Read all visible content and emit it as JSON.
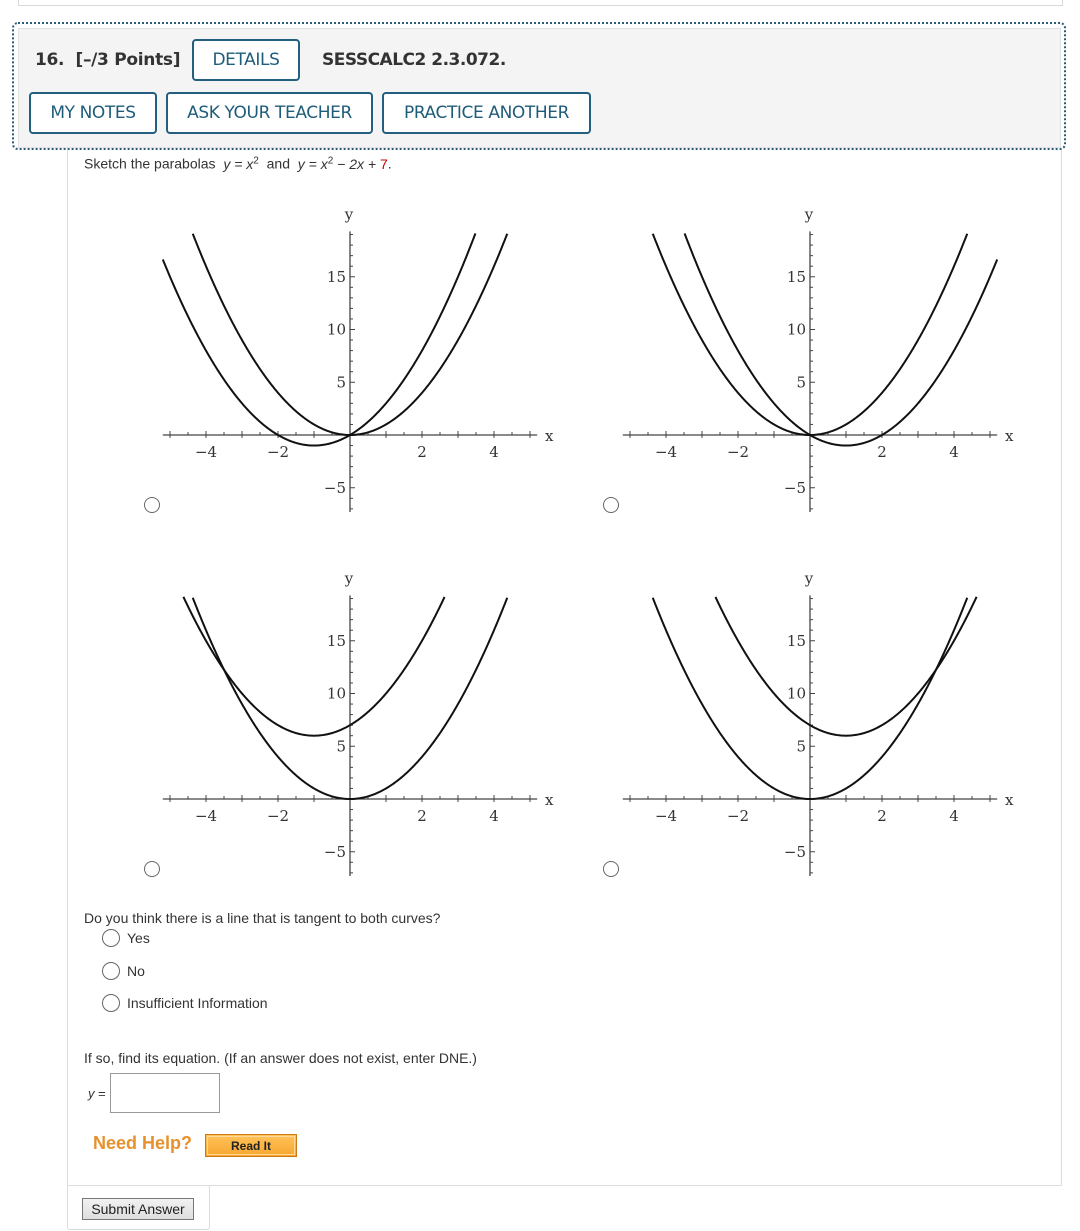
{
  "header": {
    "question_number": "16.",
    "points": "[–/3 Points]",
    "details_label": "DETAILS",
    "problem_code": "SESSCALC2 2.3.072.",
    "my_notes_label": "MY NOTES",
    "ask_teacher_label": "ASK YOUR TEACHER",
    "practice_another_label": "PRACTICE ANOTHER"
  },
  "prompt": {
    "lead": "Sketch the parabolas",
    "eq1_lhs": "y = x",
    "eq1_exp": "2",
    "conj": "and",
    "eq2_lhs": "y = x",
    "eq2_exp": "2",
    "eq2_mid": " − 2x + ",
    "eq2_const": "7",
    "end": "."
  },
  "colors": {
    "accent": "#1f5c7a",
    "need_help": "#e8912c",
    "constant_highlight": "#cc0000"
  },
  "chart_data": [
    {
      "type": "line",
      "id": "option-a",
      "xlabel": "x",
      "ylabel": "y",
      "xlim": [
        -5.2,
        5.2
      ],
      "ylim": [
        -7.3,
        19.3
      ],
      "xticks": [
        -4,
        -2,
        2,
        4
      ],
      "xtick_labels": [
        "−4",
        "−2",
        "2",
        "4"
      ],
      "yticks": [
        -5,
        5,
        10,
        15
      ],
      "ytick_labels": [
        "−5",
        "5",
        "10",
        "15"
      ],
      "grid": false,
      "series": [
        {
          "name": "y = x^2",
          "a": 1,
          "b": 0,
          "c": 0
        },
        {
          "name": "y = x^2 + 2x",
          "a": 1,
          "b": 2,
          "c": 0
        }
      ]
    },
    {
      "type": "line",
      "id": "option-b",
      "xlabel": "x",
      "ylabel": "y",
      "xlim": [
        -5.2,
        5.2
      ],
      "ylim": [
        -7.3,
        19.3
      ],
      "xticks": [
        -4,
        -2,
        2,
        4
      ],
      "xtick_labels": [
        "−4",
        "−2",
        "2",
        "4"
      ],
      "yticks": [
        -5,
        5,
        10,
        15
      ],
      "ytick_labels": [
        "−5",
        "5",
        "10",
        "15"
      ],
      "grid": false,
      "series": [
        {
          "name": "y = x^2",
          "a": 1,
          "b": 0,
          "c": 0
        },
        {
          "name": "y = x^2 − 2x",
          "a": 1,
          "b": -2,
          "c": 0
        }
      ]
    },
    {
      "type": "line",
      "id": "option-c",
      "xlabel": "x",
      "ylabel": "y",
      "xlim": [
        -5.2,
        5.2
      ],
      "ylim": [
        -7.3,
        19.3
      ],
      "xticks": [
        -4,
        -2,
        2,
        4
      ],
      "xtick_labels": [
        "−4",
        "−2",
        "2",
        "4"
      ],
      "yticks": [
        -5,
        5,
        10,
        15
      ],
      "ytick_labels": [
        "−5",
        "5",
        "10",
        "15"
      ],
      "grid": false,
      "series": [
        {
          "name": "y = x^2",
          "a": 1,
          "b": 0,
          "c": 0
        },
        {
          "name": "y = x^2 + 2x + 7",
          "a": 1,
          "b": 2,
          "c": 7
        }
      ]
    },
    {
      "type": "line",
      "id": "option-d",
      "xlabel": "x",
      "ylabel": "y",
      "xlim": [
        -5.2,
        5.2
      ],
      "ylim": [
        -7.3,
        19.3
      ],
      "xticks": [
        -4,
        -2,
        2,
        4
      ],
      "xtick_labels": [
        "−4",
        "−2",
        "2",
        "4"
      ],
      "yticks": [
        -5,
        5,
        10,
        15
      ],
      "ytick_labels": [
        "−5",
        "5",
        "10",
        "15"
      ],
      "grid": false,
      "series": [
        {
          "name": "y = x^2",
          "a": 1,
          "b": 0,
          "c": 0
        },
        {
          "name": "y = x^2 − 2x + 7",
          "a": 1,
          "b": -2,
          "c": 7
        }
      ]
    }
  ],
  "tangent_question": {
    "text": "Do you think there is a line that is tangent to both curves?",
    "options": [
      "Yes",
      "No",
      "Insufficient Information"
    ]
  },
  "equation_question": {
    "text": "If so, find its equation. (If an answer does not exist, enter DNE.)",
    "label_var": "y",
    "label_eq": " =",
    "value": ""
  },
  "help": {
    "need_help": "Need Help?",
    "read_it": "Read It"
  },
  "submit_label": "Submit Answer"
}
